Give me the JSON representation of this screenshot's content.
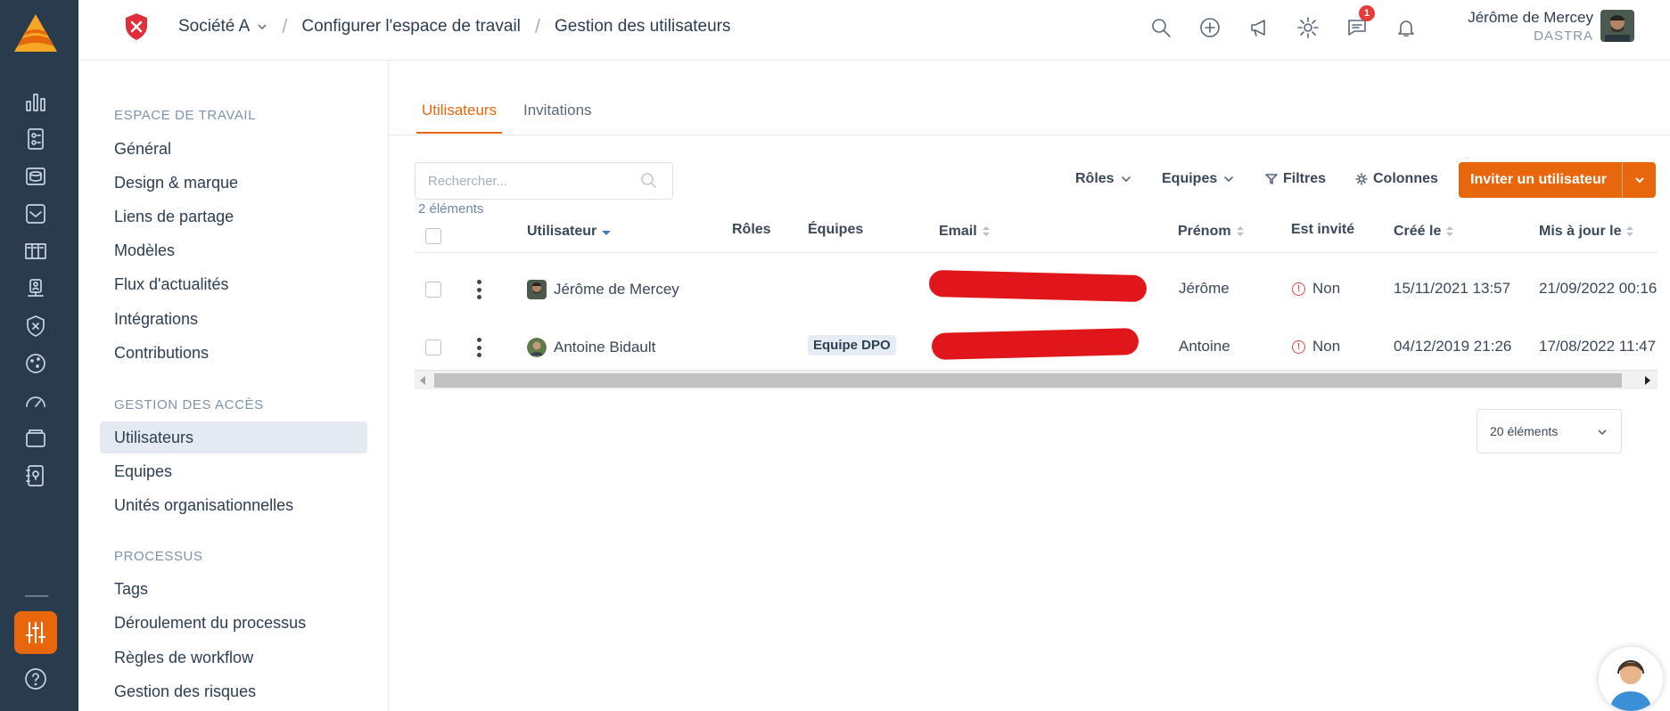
{
  "header": {
    "company": "Société A",
    "breadcrumb_1": "Configurer l'espace de travail",
    "breadcrumb_2": "Gestion des utilisateurs",
    "notifications_count": "1",
    "user_name": "Jérôme de Mercey",
    "user_org": "DASTRA"
  },
  "sidebar": {
    "section_workspace": "ESPACE DE TRAVAIL",
    "workspace_items": [
      "Général",
      "Design & marque",
      "Liens de partage",
      "Modèles",
      "Flux d'actualités",
      "Intégrations",
      "Contributions"
    ],
    "section_access": "GESTION DES ACCÈS",
    "access_items": [
      "Utilisateurs",
      "Equipes",
      "Unités organisationnelles"
    ],
    "section_process": "PROCESSUS",
    "process_items": [
      "Tags",
      "Déroulement du processus",
      "Règles de workflow",
      "Gestion des risques"
    ]
  },
  "tabs": [
    "Utilisateurs",
    "Invitations"
  ],
  "toolbar": {
    "search_placeholder": "Rechercher...",
    "count": "2 éléments",
    "roles": "Rôles",
    "teams": "Equipes",
    "filters": "Filtres",
    "columns": "Colonnes",
    "invite": "Inviter un utilisateur"
  },
  "table": {
    "headers": [
      "Utilisateur",
      "Rôles",
      "Équipes",
      "Email",
      "Prénom",
      "Est invité",
      "Créé le",
      "Mis à jour le"
    ],
    "rows": [
      {
        "user": "Jérôme de Mercey",
        "team": "",
        "firstname": "Jérôme",
        "invited": "Non",
        "created": "15/11/2021 13:57",
        "updated": "21/09/2022 00:16"
      },
      {
        "user": "Antoine Bidault",
        "team": "Equipe DPO",
        "firstname": "Antoine",
        "invited": "Non",
        "created": "04/12/2019 21:26",
        "updated": "17/08/2022 11:47"
      }
    ]
  },
  "pager": {
    "page_size": "20 éléments"
  },
  "colors": {
    "accent": "#e8660c",
    "rail": "#2b3b4e",
    "redaction": "#e0161b"
  }
}
